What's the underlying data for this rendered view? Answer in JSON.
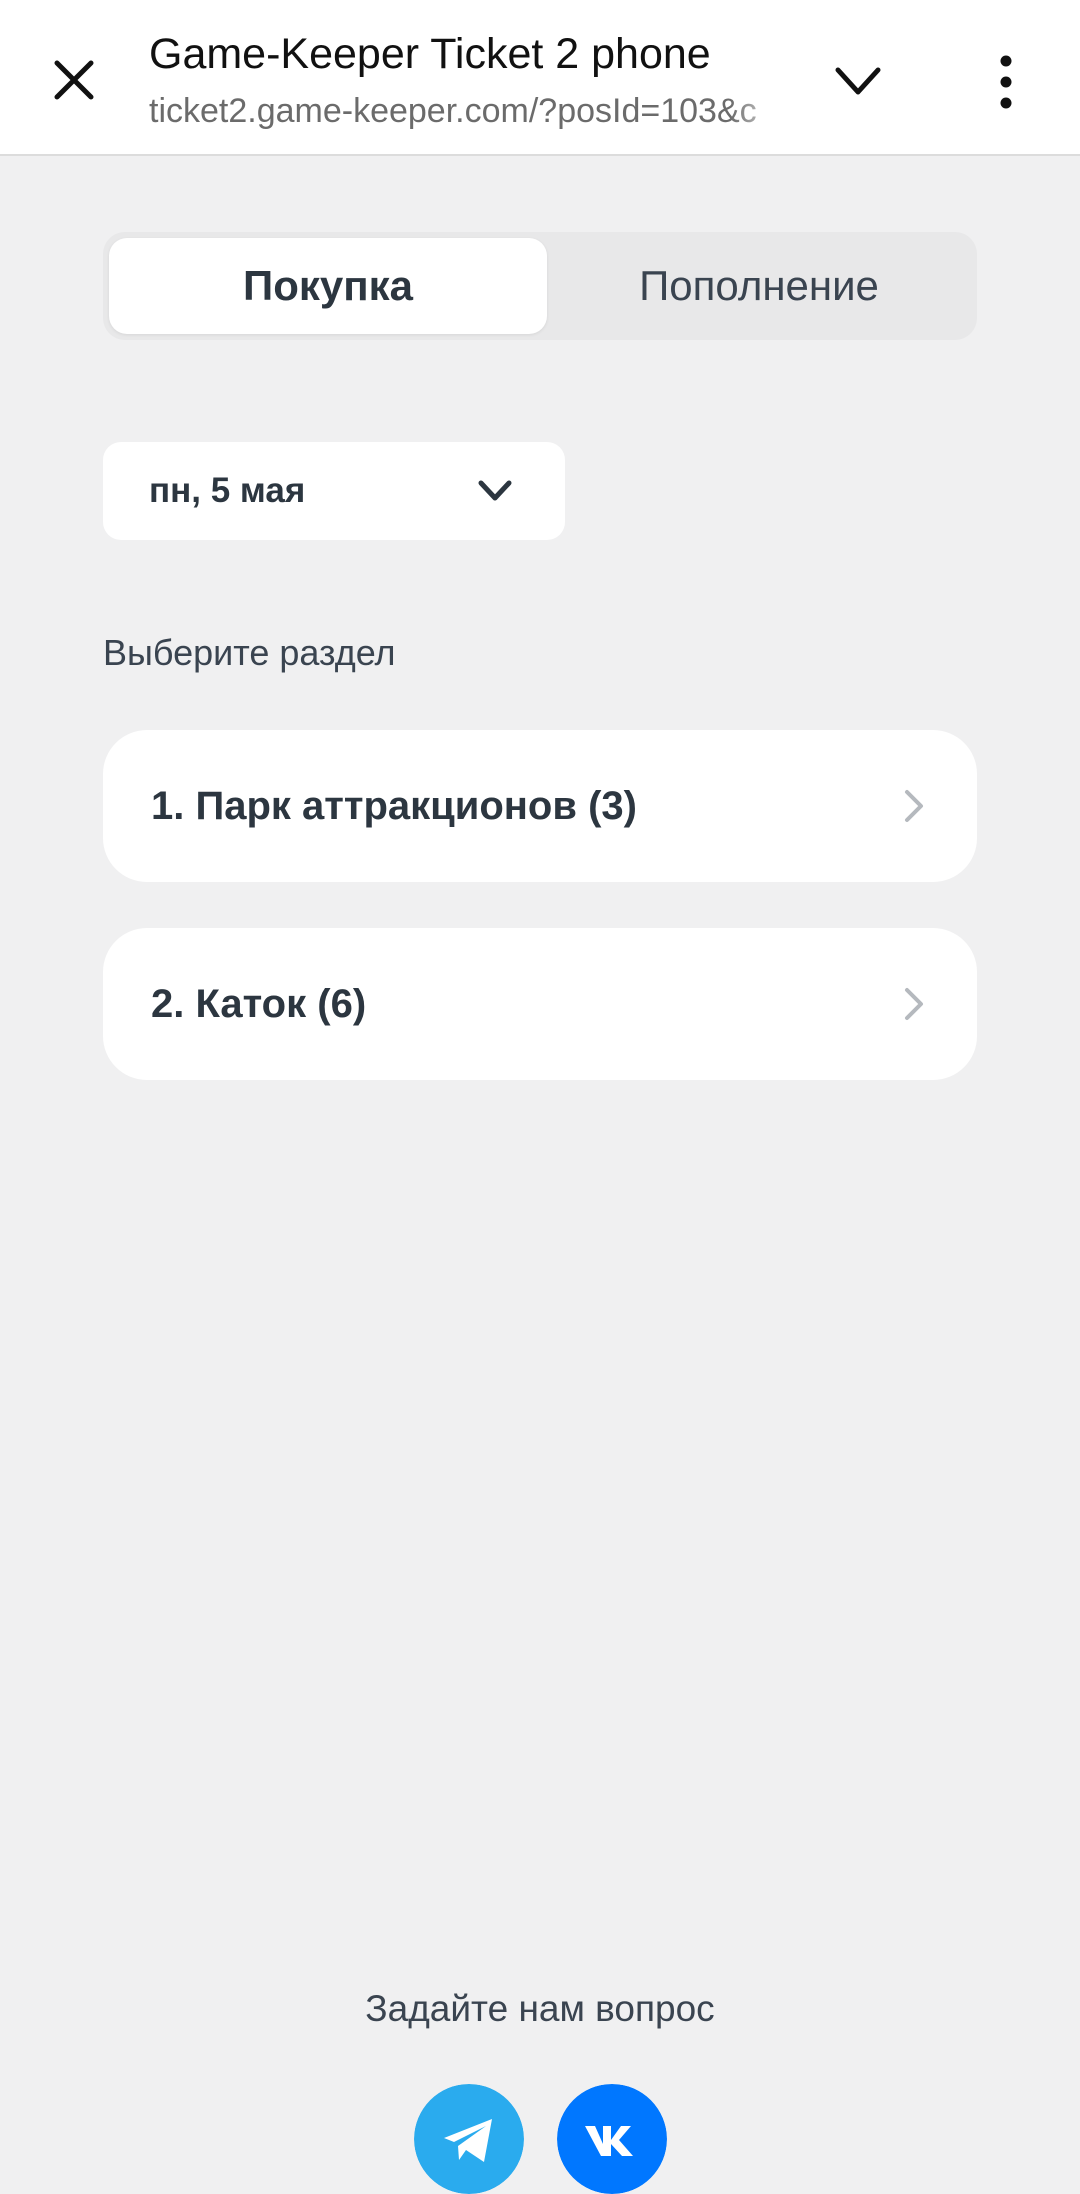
{
  "browser": {
    "title": "Game-Keeper Ticket 2 phone",
    "url": "ticket2.game-keeper.com/?posId=103&c"
  },
  "tabs": [
    {
      "label": "Покупка",
      "active": true
    },
    {
      "label": "Пополнение",
      "active": false
    }
  ],
  "date_select": {
    "value": "пн, 5 мая"
  },
  "sections": {
    "heading": "Выберите раздел",
    "items": [
      {
        "label": "1. Парк аттракционов (3)"
      },
      {
        "label": "2. Каток (6)"
      }
    ]
  },
  "footer": {
    "ask_label": "Задайте нам вопрос",
    "social": [
      {
        "icon": "telegram-icon",
        "color": "#2aabee"
      },
      {
        "icon": "vk-icon",
        "color": "#0077ff"
      }
    ]
  },
  "colors": {
    "background": "#f0f0f1",
    "card": "#ffffff",
    "text": "#2c3640",
    "chevron": "#b5b9be"
  }
}
